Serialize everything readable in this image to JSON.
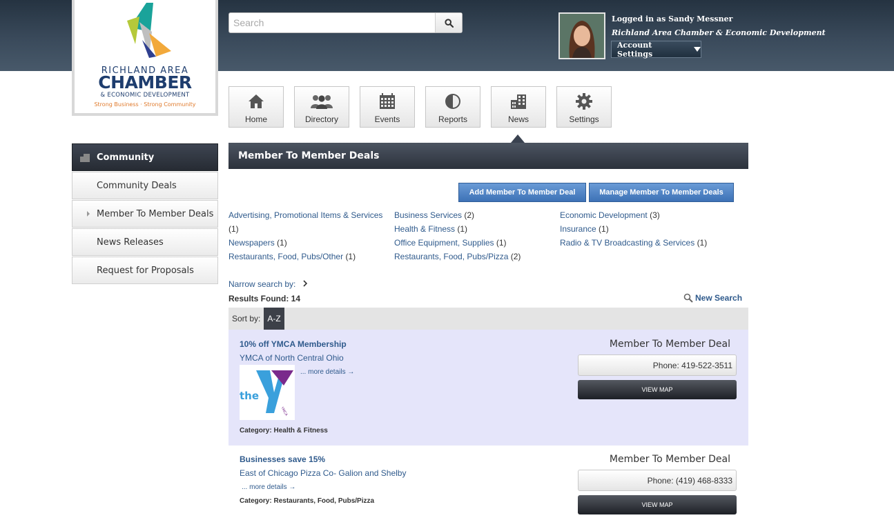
{
  "header": {
    "logo": {
      "line1": "RICHLAND AREA",
      "line2": "CHAMBER",
      "line3": "& ECONOMIC DEVELOPMENT",
      "tagline": "Strong Business · Strong Community"
    },
    "search": {
      "placeholder": "Search",
      "value": ""
    },
    "user": {
      "logged_in_text": "Logged in as Sandy Messner",
      "organization": "Richland Area Chamber & Economic Development",
      "account_settings_label": "Account Settings"
    }
  },
  "nav": {
    "tiles": [
      {
        "label": "Home",
        "icon": "home-icon"
      },
      {
        "label": "Directory",
        "icon": "people-icon"
      },
      {
        "label": "Events",
        "icon": "calendar-icon"
      },
      {
        "label": "Reports",
        "icon": "pie-chart-icon"
      },
      {
        "label": "News",
        "icon": "building-icon"
      },
      {
        "label": "Settings",
        "icon": "gear-icon"
      }
    ],
    "active": "News"
  },
  "sidebar": {
    "items": [
      {
        "label": "Community",
        "active": true
      },
      {
        "label": "Community Deals"
      },
      {
        "label": "Member To Member Deals",
        "current": true
      },
      {
        "label": "News Releases"
      },
      {
        "label": "Request for Proposals"
      }
    ]
  },
  "main": {
    "section_title": "Member To Member Deals",
    "add_button": "Add Member To Member Deal",
    "manage_button": "Manage Member To Member Deals",
    "categories": [
      {
        "name": "Advertising, Promotional Items & Services",
        "count": "(1)"
      },
      {
        "name": "Business Services",
        "count": "(2)"
      },
      {
        "name": "Economic Development",
        "count": "(3)"
      },
      {
        "name": "Health & Fitness",
        "count": "(1)"
      },
      {
        "name": "Insurance",
        "count": "(1)"
      },
      {
        "name": "Newspapers",
        "count": "(1)"
      },
      {
        "name": "Office Equipment, Supplies",
        "count": "(1)"
      },
      {
        "name": "Radio & TV Broadcasting & Services",
        "count": "(1)"
      },
      {
        "name": "Restaurants, Food, Pubs/Other",
        "count": "(1)"
      },
      {
        "name": "Restaurants, Food, Pubs/Pizza",
        "count": "(2)"
      }
    ],
    "narrow_label": "Narrow search by:",
    "results_label": "Results Found:",
    "results_count": "14",
    "new_search_label": "New Search",
    "sort_label": "Sort by:",
    "sort_value": "A-Z",
    "results": [
      {
        "title": "10% off YMCA Membership",
        "business": "YMCA of North Central Ohio",
        "more": "... more details →",
        "category_label": "Category:",
        "category": "Health & Fitness",
        "type": "Member To Member Deal",
        "phone": "Phone: 419-522-3511",
        "map_label": "VIEW MAP",
        "logo_text": "the",
        "logo_small": "YMCA"
      },
      {
        "title": "Businesses save 15%",
        "business": "East of Chicago Pizza Co- Galion and Shelby",
        "more": "... more details →",
        "category_label": "Category:",
        "category": "Restaurants, Food, Pubs/Pizza",
        "type": "Member To Member Deal",
        "phone": "Phone: (419) 468-8333",
        "map_label": "VIEW MAP"
      }
    ]
  },
  "colors": {
    "header_dark": "#253341",
    "link_blue": "#2f5a8c",
    "button_blue": "#3d72b6",
    "highlight_row": "#e5e5fa"
  }
}
